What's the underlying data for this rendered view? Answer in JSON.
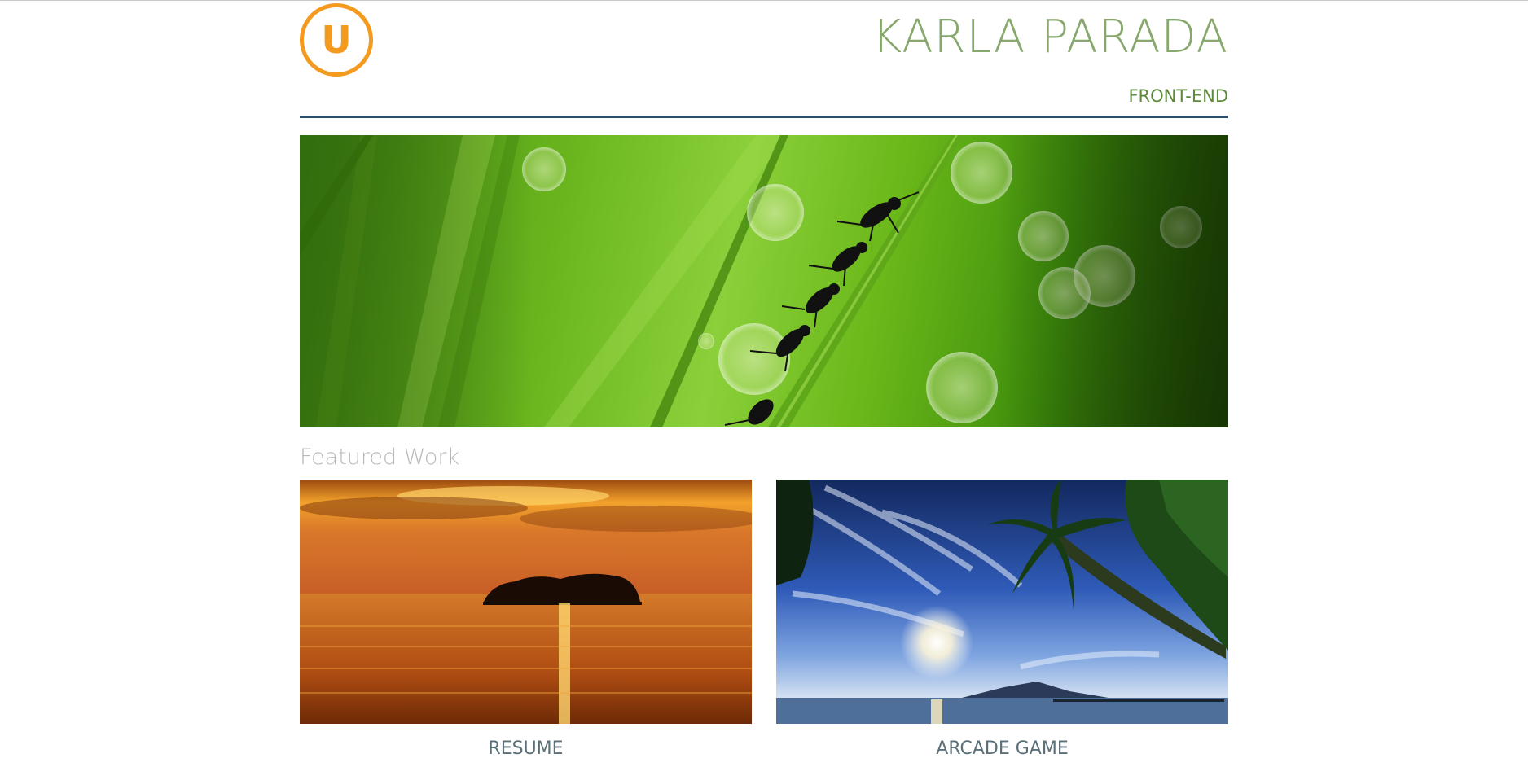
{
  "header": {
    "logo_letter": "U",
    "title": "KARLA PARADA",
    "subtitle": "FRONT-END"
  },
  "hero": {
    "image": "green-grass-ants-photo"
  },
  "featured": {
    "heading": "Featured Work",
    "items": [
      {
        "label": "RESUME",
        "image": "sunset-island-photo"
      },
      {
        "label": "ARCADE GAME",
        "image": "tropical-sky-palm-photo"
      }
    ]
  },
  "colors": {
    "logo": "#f39a1f",
    "title": "#87a86c",
    "subtitle": "#5e8a3c",
    "rule": "#2b4d6e",
    "heading": "#b9b9b9",
    "card_label": "#5b6f78"
  }
}
